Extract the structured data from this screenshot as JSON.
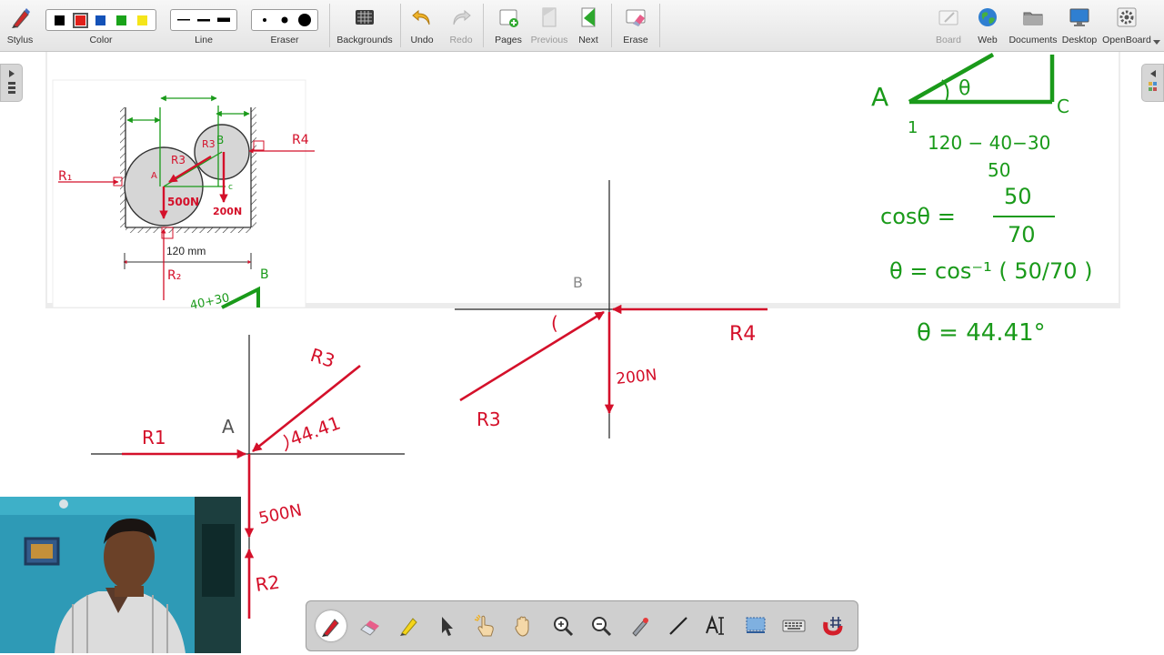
{
  "toolbar": {
    "stylus_label": "Stylus",
    "color_label": "Color",
    "line_label": "Line",
    "eraser_label": "Eraser",
    "backgrounds_label": "Backgrounds",
    "undo_label": "Undo",
    "redo_label": "Redo",
    "pages_label": "Pages",
    "previous_label": "Previous",
    "next_label": "Next",
    "erase_label": "Erase",
    "board_label": "Board",
    "web_label": "Web",
    "documents_label": "Documents",
    "desktop_label": "Desktop",
    "openboard_label": "OpenBoard",
    "colors": [
      "#000000",
      "#e0201a",
      "#1452b8",
      "#1aa31a",
      "#f5e51a"
    ],
    "selected_color": "#e0201a"
  },
  "figure": {
    "dimension": "120 mm",
    "labels": {
      "r1": "R₁",
      "r2": "R₂",
      "r3": "R3",
      "r3b": "R3",
      "r4": "R4",
      "a": "A",
      "b": "B",
      "c": "c",
      "b2": "B",
      "w1": "500N",
      "w2": "200N",
      "partial": "40+30"
    }
  },
  "notes": {
    "triangle_a": "A",
    "triangle_c": "C",
    "theta": "θ",
    "one": "1",
    "line1": "120 − 40−30",
    "line2": "50",
    "cos_lhs": "cosθ =",
    "cos_num": "50",
    "cos_den": "70",
    "theta_eq": "θ = cos⁻¹ ( 50/70 )",
    "result": "θ = 44.41°"
  },
  "fbd_a": {
    "point": "A",
    "r1": "R1",
    "r2": "R2",
    "r3": "R3",
    "weight": "500N",
    "angle": "44.41"
  },
  "fbd_b": {
    "point": "B",
    "r3": "R3",
    "r4": "R4",
    "weight": "200N",
    "arc": "("
  }
}
